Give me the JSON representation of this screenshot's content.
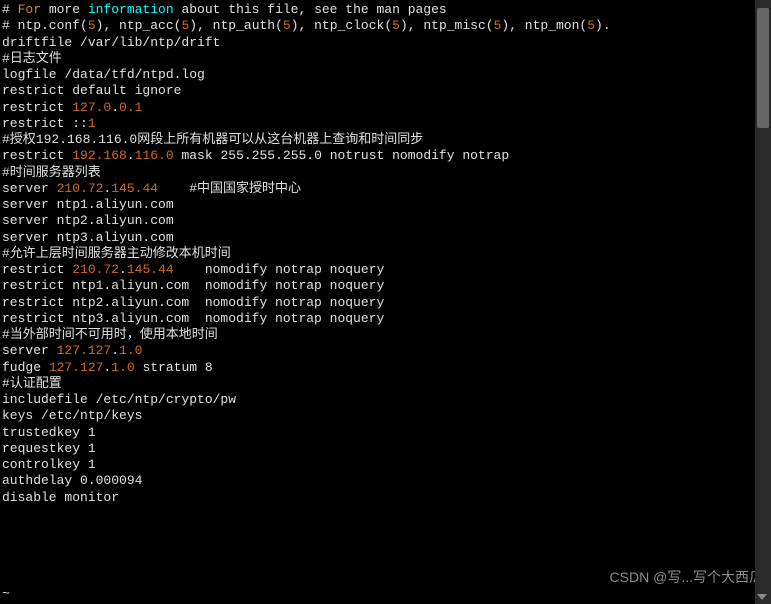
{
  "lines": [
    {
      "segments": [
        {
          "t": "# ",
          "c": "plain"
        },
        {
          "t": "For",
          "c": "orange"
        },
        {
          "t": " more ",
          "c": "plain"
        },
        {
          "t": "information",
          "c": "cyan"
        },
        {
          "t": " about this file, see the man pages",
          "c": "plain"
        }
      ]
    },
    {
      "segments": [
        {
          "t": "# ntp.conf(",
          "c": "plain"
        },
        {
          "t": "5",
          "c": "num"
        },
        {
          "t": "), ntp_acc(",
          "c": "plain"
        },
        {
          "t": "5",
          "c": "num"
        },
        {
          "t": "), ntp_auth(",
          "c": "plain"
        },
        {
          "t": "5",
          "c": "num"
        },
        {
          "t": "), ntp_clock(",
          "c": "plain"
        },
        {
          "t": "5",
          "c": "num"
        },
        {
          "t": "), ntp_misc(",
          "c": "plain"
        },
        {
          "t": "5",
          "c": "num"
        },
        {
          "t": "), ntp_mon(",
          "c": "plain"
        },
        {
          "t": "5",
          "c": "num"
        },
        {
          "t": ").",
          "c": "plain"
        }
      ]
    },
    {
      "segments": [
        {
          "t": "",
          "c": "plain"
        }
      ]
    },
    {
      "segments": [
        {
          "t": "driftfile /var/lib/ntp/drift",
          "c": "plain"
        }
      ]
    },
    {
      "segments": [
        {
          "t": "",
          "c": "plain"
        }
      ]
    },
    {
      "segments": [
        {
          "t": "#日志文件",
          "c": "plain"
        }
      ]
    },
    {
      "segments": [
        {
          "t": "logfile /data/tfd/ntpd.log",
          "c": "plain"
        }
      ]
    },
    {
      "segments": [
        {
          "t": "",
          "c": "plain"
        }
      ]
    },
    {
      "segments": [
        {
          "t": "restrict default ignore",
          "c": "plain"
        }
      ]
    },
    {
      "segments": [
        {
          "t": "restrict ",
          "c": "plain"
        },
        {
          "t": "127.0",
          "c": "num"
        },
        {
          "t": ".",
          "c": "plain"
        },
        {
          "t": "0.1",
          "c": "num"
        }
      ]
    },
    {
      "segments": [
        {
          "t": "restrict ::",
          "c": "plain"
        },
        {
          "t": "1",
          "c": "num"
        }
      ]
    },
    {
      "segments": [
        {
          "t": "",
          "c": "plain"
        }
      ]
    },
    {
      "segments": [
        {
          "t": "#授权192.168.116.0网段上所有机器可以从这台机器上查询和时间同步",
          "c": "plain"
        }
      ]
    },
    {
      "segments": [
        {
          "t": "restrict ",
          "c": "plain"
        },
        {
          "t": "192.168",
          "c": "num"
        },
        {
          "t": ".",
          "c": "plain"
        },
        {
          "t": "116.0",
          "c": "num"
        },
        {
          "t": " mask ",
          "c": "plain"
        },
        {
          "t": "255.255",
          "c": "plain"
        },
        {
          "t": ".",
          "c": "plain"
        },
        {
          "t": "255.0",
          "c": "plain"
        },
        {
          "t": " notrust nomodify notrap",
          "c": "plain"
        }
      ]
    },
    {
      "segments": [
        {
          "t": "",
          "c": "plain"
        }
      ]
    },
    {
      "segments": [
        {
          "t": "#时间服务器列表",
          "c": "plain"
        }
      ]
    },
    {
      "segments": [
        {
          "t": "server ",
          "c": "plain"
        },
        {
          "t": "210.72",
          "c": "num"
        },
        {
          "t": ".",
          "c": "plain"
        },
        {
          "t": "145.44",
          "c": "num"
        },
        {
          "t": "    #中国国家授时中心",
          "c": "plain"
        }
      ]
    },
    {
      "segments": [
        {
          "t": "server ntp1.aliyun.com",
          "c": "plain"
        }
      ]
    },
    {
      "segments": [
        {
          "t": "server ntp2.aliyun.com",
          "c": "plain"
        }
      ]
    },
    {
      "segments": [
        {
          "t": "server ntp3.aliyun.com",
          "c": "plain"
        }
      ]
    },
    {
      "segments": [
        {
          "t": "",
          "c": "plain"
        }
      ]
    },
    {
      "segments": [
        {
          "t": "#允许上层时间服务器主动修改本机时间",
          "c": "plain"
        }
      ]
    },
    {
      "segments": [
        {
          "t": "restrict ",
          "c": "plain"
        },
        {
          "t": "210.72",
          "c": "num"
        },
        {
          "t": ".",
          "c": "plain"
        },
        {
          "t": "145.44",
          "c": "num"
        },
        {
          "t": "    nomodify notrap noquery",
          "c": "plain"
        }
      ]
    },
    {
      "segments": [
        {
          "t": "restrict ntp1.aliyun.com  nomodify notrap noquery",
          "c": "plain"
        }
      ]
    },
    {
      "segments": [
        {
          "t": "restrict ntp2.aliyun.com  nomodify notrap noquery",
          "c": "plain"
        }
      ]
    },
    {
      "segments": [
        {
          "t": "restrict ntp3.aliyun.com  nomodify notrap noquery",
          "c": "plain"
        }
      ]
    },
    {
      "segments": [
        {
          "t": "",
          "c": "plain"
        }
      ]
    },
    {
      "segments": [
        {
          "t": "#当外部时间不可用时，使用本地时间",
          "c": "plain"
        }
      ]
    },
    {
      "segments": [
        {
          "t": "server ",
          "c": "plain"
        },
        {
          "t": "127.127",
          "c": "num"
        },
        {
          "t": ".",
          "c": "plain"
        },
        {
          "t": "1.0",
          "c": "num"
        }
      ]
    },
    {
      "segments": [
        {
          "t": "fudge ",
          "c": "plain"
        },
        {
          "t": "127.127",
          "c": "num"
        },
        {
          "t": ".",
          "c": "plain"
        },
        {
          "t": "1.0",
          "c": "num"
        },
        {
          "t": " stratum ",
          "c": "plain"
        },
        {
          "t": "8",
          "c": "plain"
        }
      ]
    },
    {
      "segments": [
        {
          "t": "",
          "c": "plain"
        }
      ]
    },
    {
      "segments": [
        {
          "t": "#认证配置",
          "c": "plain"
        }
      ]
    },
    {
      "segments": [
        {
          "t": "includefile /etc/ntp/crypto/pw",
          "c": "plain"
        }
      ]
    },
    {
      "segments": [
        {
          "t": "keys /etc/ntp/keys",
          "c": "plain"
        }
      ]
    },
    {
      "segments": [
        {
          "t": "trustedkey ",
          "c": "plain"
        },
        {
          "t": "1",
          "c": "plain"
        }
      ]
    },
    {
      "segments": [
        {
          "t": "requestkey ",
          "c": "plain"
        },
        {
          "t": "1",
          "c": "plain"
        }
      ]
    },
    {
      "segments": [
        {
          "t": "controlkey ",
          "c": "plain"
        },
        {
          "t": "1",
          "c": "plain"
        }
      ]
    },
    {
      "segments": [
        {
          "t": "authdelay ",
          "c": "plain"
        },
        {
          "t": "0.000094",
          "c": "plain"
        }
      ]
    },
    {
      "segments": [
        {
          "t": "disable monitor",
          "c": "plain"
        }
      ]
    }
  ],
  "cursor": "~",
  "watermark": "CSDN @写...写个大西瓜"
}
